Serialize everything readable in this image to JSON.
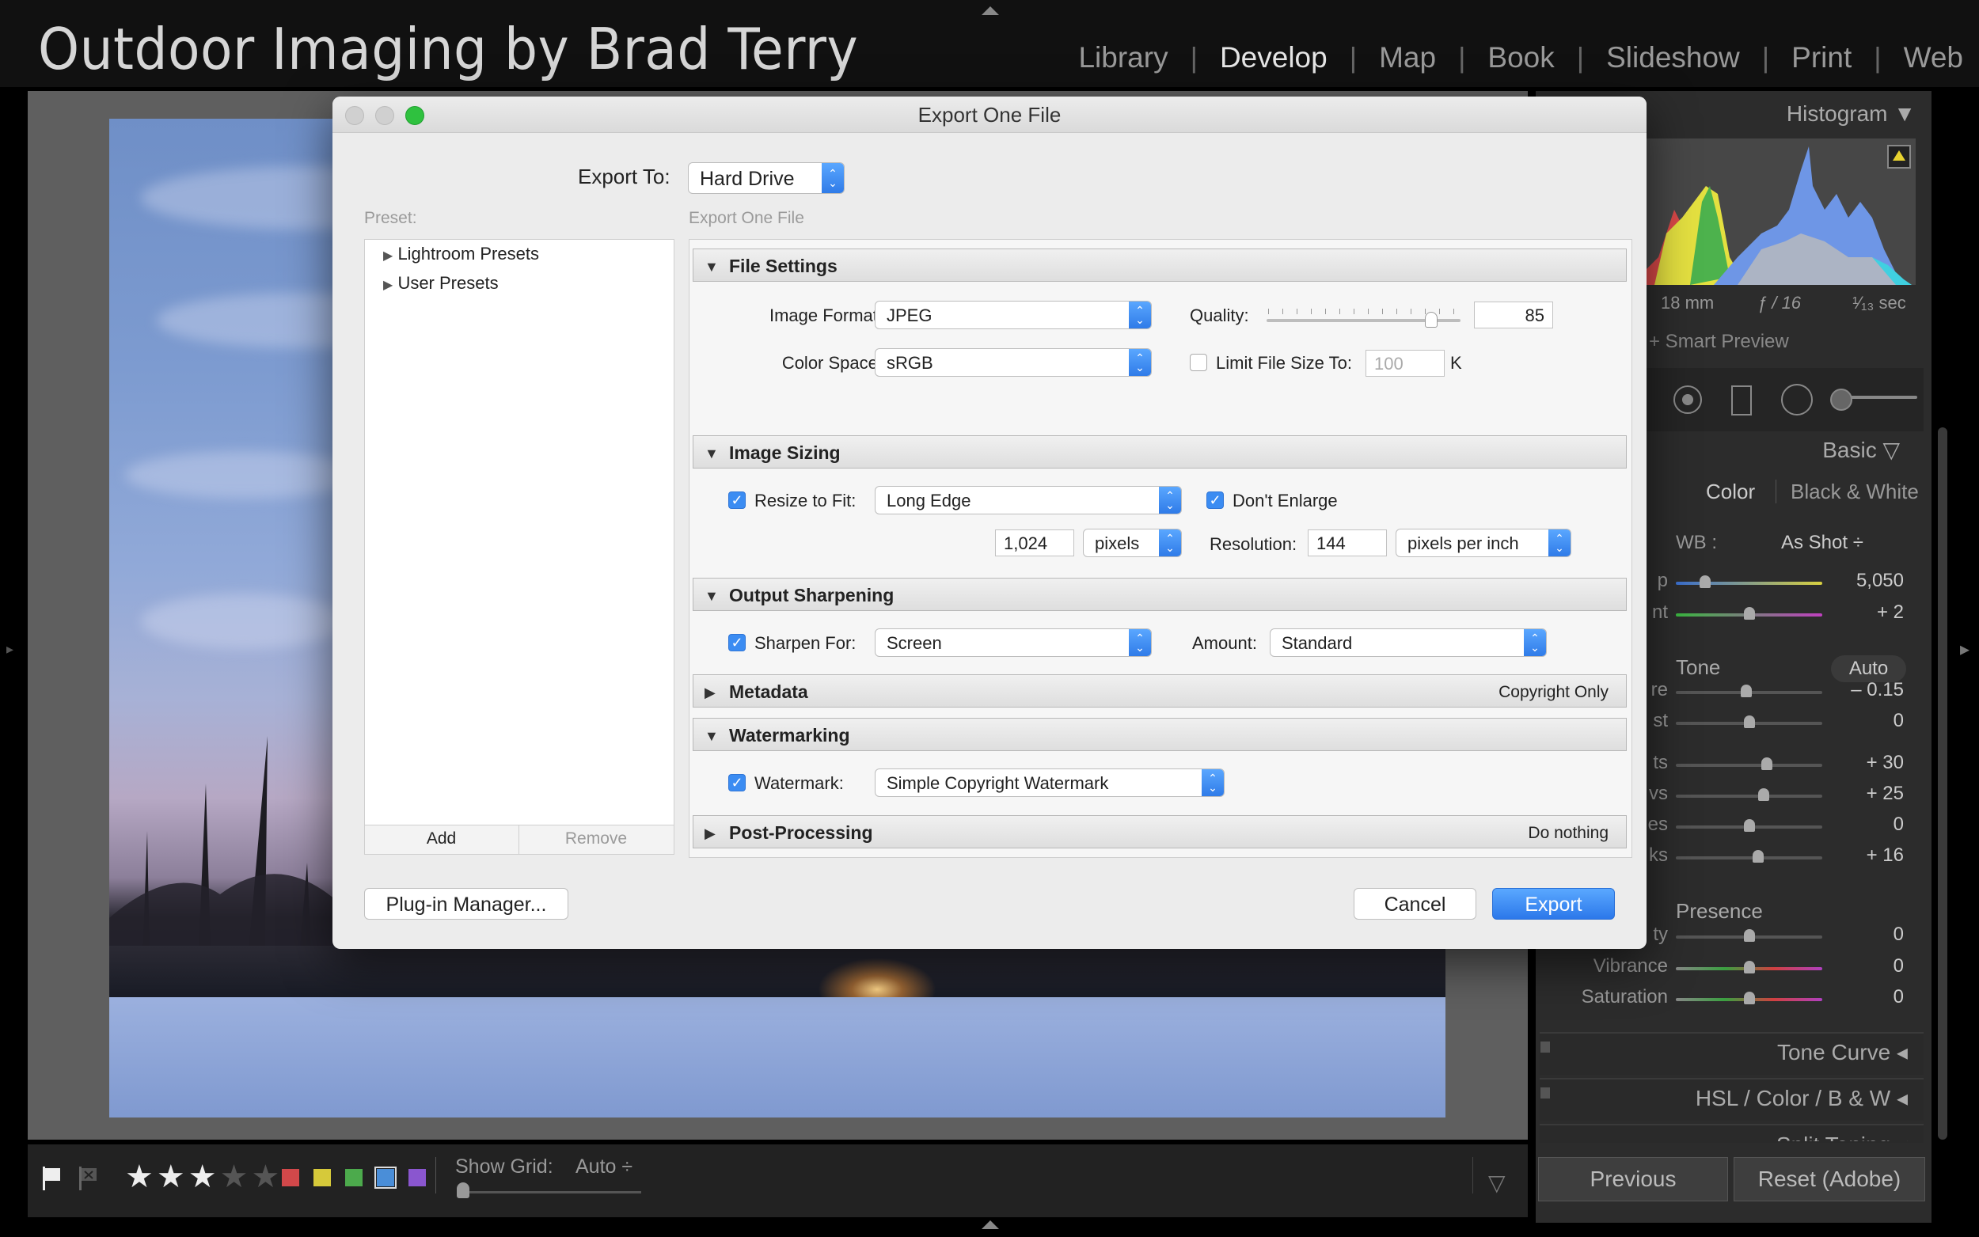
{
  "app": {
    "identity_plate": "Outdoor Imaging by Brad Terry",
    "modules": [
      {
        "label": "Library",
        "active": false
      },
      {
        "label": "Develop",
        "active": true
      },
      {
        "label": "Map",
        "active": false
      },
      {
        "label": "Book",
        "active": false
      },
      {
        "label": "Slideshow",
        "active": false
      },
      {
        "label": "Print",
        "active": false
      },
      {
        "label": "Web",
        "active": false
      }
    ]
  },
  "toolbar": {
    "rating": 3,
    "rating_max": 5,
    "color_labels": [
      "#d2484a",
      "#d6c93a",
      "#4caa4c",
      "#4a8ed8",
      "#8a56cf"
    ],
    "show_grid_label": "Show Grid:",
    "show_grid_value": "Auto ÷"
  },
  "right_panel": {
    "histogram_title": "Histogram ▼",
    "focal_length": "18 mm",
    "aperture": "ƒ / 16",
    "shutter": "¹⁄₁₃ sec",
    "smart_preview": "+ Smart Preview",
    "basic_title": "Basic ▽",
    "treatment_color": "Color",
    "treatment_bw": "Black & White",
    "wb_label": "WB :",
    "wb_value": "As Shot ÷",
    "temp": {
      "label": "p",
      "value": "5,050",
      "level": 0.2
    },
    "tint": {
      "label": "nt",
      "value": "+ 2",
      "level": 0.5
    },
    "tone_label": "Tone",
    "auto_label": "Auto",
    "exposure": {
      "label": "re",
      "value": "– 0.15",
      "level": 0.48
    },
    "contrast": {
      "label": "st",
      "value": "0",
      "level": 0.5
    },
    "highlights": {
      "label": "ts",
      "value": "+ 30",
      "level": 0.62
    },
    "shadows": {
      "label": "vs",
      "value": "+ 25",
      "level": 0.6
    },
    "whites": {
      "label": "es",
      "value": "0",
      "level": 0.5
    },
    "blacks": {
      "label": "ks",
      "value": "+ 16",
      "level": 0.56
    },
    "presence_label": "Presence",
    "clarity": {
      "label": "ty",
      "value": "0",
      "level": 0.5
    },
    "vibrance": {
      "label": "Vibrance",
      "value": "0",
      "level": 0.5
    },
    "saturation": {
      "label": "Saturation",
      "value": "0",
      "level": 0.5
    },
    "tone_curve": "Tone Curve ◂",
    "hsl": "HSL  /  Color  /  B & W ◂",
    "split_toning": "Split Toning ◂",
    "previous_btn": "Previous",
    "reset_btn": "Reset (Adobe)"
  },
  "dialog": {
    "title": "Export One File",
    "export_to_label": "Export To:",
    "export_to_value": "Hard Drive",
    "preset_label": "Preset:",
    "presets": [
      "Lightroom Presets",
      "User Presets"
    ],
    "add_btn": "Add",
    "remove_btn": "Remove",
    "main_header": "Export One File",
    "file_settings": {
      "title": "File Settings",
      "image_format_label": "Image Format:",
      "image_format_value": "JPEG",
      "quality_label": "Quality:",
      "quality_value": "85",
      "quality_level": 0.85,
      "color_space_label": "Color Space:",
      "color_space_value": "sRGB",
      "limit_label": "Limit File Size To:",
      "limit_checked": false,
      "limit_placeholder": "100",
      "limit_unit": "K"
    },
    "image_sizing": {
      "title": "Image Sizing",
      "resize_label": "Resize to Fit:",
      "resize_checked": true,
      "resize_value": "Long Edge",
      "dont_enlarge_label": "Don't Enlarge",
      "dont_enlarge_checked": true,
      "size_value": "1,024",
      "size_unit": "pixels",
      "resolution_label": "Resolution:",
      "resolution_value": "144",
      "resolution_unit": "pixels per inch"
    },
    "output_sharpening": {
      "title": "Output Sharpening",
      "sharpen_label": "Sharpen For:",
      "sharpen_checked": true,
      "sharpen_value": "Screen",
      "amount_label": "Amount:",
      "amount_value": "Standard"
    },
    "metadata": {
      "title": "Metadata",
      "summary": "Copyright Only"
    },
    "watermarking": {
      "title": "Watermarking",
      "watermark_label": "Watermark:",
      "watermark_checked": true,
      "watermark_value": "Simple Copyright Watermark"
    },
    "post_processing": {
      "title": "Post-Processing",
      "summary": "Do nothing"
    },
    "plugin_btn": "Plug-in Manager...",
    "cancel_btn": "Cancel",
    "export_btn": "Export"
  }
}
